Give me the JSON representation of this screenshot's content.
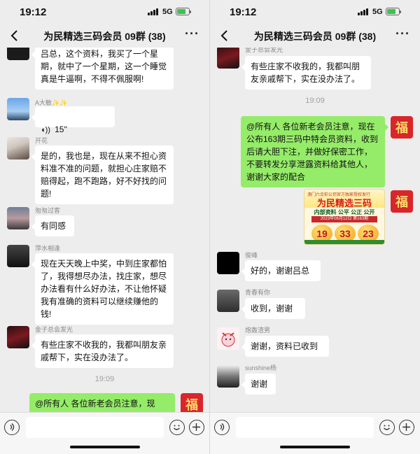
{
  "status": {
    "time": "19:12",
    "network": "5G"
  },
  "nav": {
    "title": "为民精选三码会员 09群 (38)"
  },
  "left": {
    "m1_text": "吕总，这个资料，我买了一个星期，就中了一个星期，这一个睡觉真是牛逼啊，不得不佩服啊!",
    "m2_sender": "A大敏✨✨",
    "m2_voice": "15''",
    "m3_sender": "开花",
    "m3_text": "是的，我也是，现在从来不担心资料准不准的问题，就担心庄家赔不赔得起，跑不跑路，好不好找的问题!",
    "m4_sender": "匆匆过客",
    "m4_text": "有同感",
    "m5_sender": "萍水相逢",
    "m5_text": "现在天天晚上中奖，中到庄家都怕了，我得想尽办法，找庄家，想尽办法看有什么好办法，不让他怀疑我有准确的资料可以继续赚他的钱!",
    "m6_sender": "金子总会发光",
    "m6_text": "有些庄家不收我的，我都叫朋友亲戚帮下，实在没办法了。",
    "timestamp": "19:09",
    "m7_text": "@所有人  各位新老会员注意，现"
  },
  "right": {
    "m1_sender": "金子总会发光",
    "m1_text": "有些庄家不收我的，我都叫朋友亲戚帮下，实在没办法了。",
    "timestamp": "19:09",
    "m2_text": "@所有人  各位新老会员注意，现在公布163期三码中特会员资料，收到后请大胆下注，并做好保密工作，不要转发分享泄露资料给其他人，谢谢大家的配合",
    "poster": {
      "head": "澳门六合彩公司官方独家授权发行",
      "title": "为民精选三码",
      "sub": "内部资料  公平 公正 公开",
      "date": "2023年06月12日 第163期",
      "balls": [
        "19",
        "33",
        "23"
      ]
    },
    "m3_sender": "俊峰",
    "m3_text": "好的，谢谢吕总",
    "m4_sender": "青春有你",
    "m4_text": "收到，谢谢",
    "m5_sender": "炮轰渣男",
    "m5_text": "谢谢，资料已收到",
    "m6_sender": "sunshine杨",
    "m6_text": "谢谢"
  },
  "colors": {
    "bubble_out": "#95ec69",
    "bubble_in": "#ffffff",
    "background": "#ededed"
  },
  "icons": {
    "back": "chevron-left-icon",
    "more": "more-dots-icon",
    "voice": "voice-icon",
    "emoji": "emoji-icon",
    "plus": "plus-icon",
    "red_avatar": "fu"
  }
}
